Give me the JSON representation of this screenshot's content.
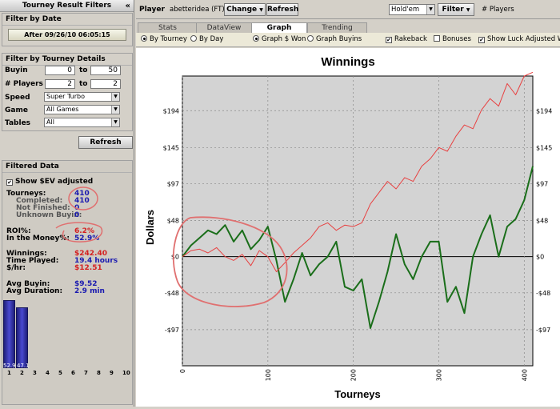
{
  "left_panel": {
    "title": "Tourney Result Filters",
    "collapse_icon": "«",
    "filter_date": {
      "heading": "Filter by Date",
      "button": "After 09/26/10 06:05:15"
    },
    "filter_details": {
      "heading": "Filter by Tourney Details",
      "buyin_label": "Buyin",
      "buyin_from": "0",
      "buyin_to": "50",
      "players_label": "# Players",
      "players_from": "2",
      "players_to": "2",
      "to_label": "to",
      "speed_label": "Speed",
      "speed_value": "Super Turbo",
      "game_label": "Game",
      "game_value": "All Games",
      "tables_label": "Tables",
      "tables_value": "All",
      "refresh": "Refresh"
    },
    "filtered": {
      "heading": "Filtered Data",
      "show_ev": "Show $EV adjusted",
      "show_ev_checked": true,
      "tourneys_label": "Tourneys:",
      "tourneys": "410",
      "completed_label": "Completed:",
      "completed": "410",
      "not_finished_label": "Not Finished:",
      "not_finished": "0",
      "unknown_label": "Unknown Buyin:",
      "unknown": "0",
      "roi_label": "ROI%:",
      "roi": "6.2%",
      "itm_label": "In the Money%:",
      "itm": "52.9%",
      "winnings_label": "Winnings:",
      "winnings": "$242.40",
      "time_label": "Time Played:",
      "time": "19.4 hours",
      "hr_label": "$/hr:",
      "hr": "$12.51",
      "avg_buyin_label": "Avg Buyin:",
      "avg_buyin": "$9.52",
      "avg_dur_label": "Avg Duration:",
      "avg_dur": "2.9 min"
    },
    "histogram": {
      "bars": [
        {
          "x": "1",
          "pct": 52.9,
          "label": "52.9"
        },
        {
          "x": "2",
          "pct": 47.1,
          "label": "47.1"
        }
      ],
      "x_labels": [
        "1",
        "2",
        "3",
        "4",
        "5",
        "6",
        "7",
        "8",
        "9",
        "10"
      ]
    }
  },
  "top_bar": {
    "player_label": "Player",
    "player_name": "abetteridea (FT)",
    "change": "Change",
    "refresh": "Refresh",
    "game_select": "Hold'em",
    "filter": "Filter",
    "players_hint": "# Players"
  },
  "tabs": [
    "Stats",
    "DataView",
    "Graph",
    "Trending"
  ],
  "active_tab": "Graph",
  "options": {
    "by_tourney": "By Tourney",
    "by_day": "By Day",
    "graph_won": "Graph $ Won",
    "graph_buyins": "Graph Buyins",
    "rakeback": "Rakeback",
    "bonuses": "Bonuses",
    "show_luck": "Show Luck Adjusted Win"
  },
  "colors": {
    "actual_line": "#1a6e1a",
    "ev_line": "#e84040",
    "plot_bg": "#d3d3d3",
    "annotation": "#e07070"
  },
  "chart_data": {
    "type": "line",
    "title": "Winnings",
    "xlabel": "Tourneys",
    "ylabel": "Dollars",
    "xlim": [
      0,
      410
    ],
    "ylim": [
      -145,
      240
    ],
    "x_ticks": [
      0,
      100,
      200,
      300,
      400
    ],
    "y_ticks": [
      -97,
      -48,
      0,
      48,
      97,
      145,
      194
    ],
    "y_tick_labels": [
      "-$97",
      "-$48",
      "$0",
      "$48",
      "$97",
      "$145",
      "$194"
    ],
    "grid": true,
    "series": [
      {
        "role": "actual",
        "x": [
          0,
          10,
          20,
          30,
          40,
          50,
          60,
          70,
          80,
          90,
          100,
          110,
          120,
          130,
          140,
          150,
          160,
          170,
          180,
          190,
          200,
          210,
          220,
          230,
          240,
          250,
          260,
          270,
          280,
          290,
          300,
          310,
          320,
          330,
          340,
          350,
          360,
          370,
          380,
          390,
          400,
          410
        ],
        "y": [
          0,
          15,
          25,
          35,
          30,
          42,
          20,
          35,
          10,
          22,
          40,
          -5,
          -60,
          -30,
          5,
          -25,
          -10,
          0,
          20,
          -40,
          -45,
          -30,
          -95,
          -60,
          -20,
          30,
          -10,
          -30,
          0,
          20,
          20,
          -60,
          -40,
          -75,
          0,
          30,
          55,
          0,
          40,
          50,
          75,
          120
        ]
      },
      {
        "role": "ev_adjusted",
        "x": [
          0,
          10,
          20,
          30,
          40,
          50,
          60,
          70,
          80,
          90,
          100,
          110,
          120,
          130,
          140,
          150,
          160,
          170,
          180,
          190,
          200,
          210,
          220,
          230,
          240,
          250,
          260,
          270,
          280,
          290,
          300,
          310,
          320,
          330,
          340,
          350,
          360,
          370,
          380,
          390,
          400,
          410
        ],
        "y": [
          0,
          8,
          10,
          5,
          12,
          0,
          -5,
          3,
          -12,
          8,
          0,
          -20,
          -8,
          5,
          15,
          25,
          40,
          45,
          35,
          42,
          40,
          45,
          70,
          85,
          100,
          90,
          105,
          100,
          120,
          130,
          145,
          140,
          160,
          175,
          170,
          195,
          210,
          200,
          230,
          215,
          240,
          245
        ]
      }
    ]
  }
}
